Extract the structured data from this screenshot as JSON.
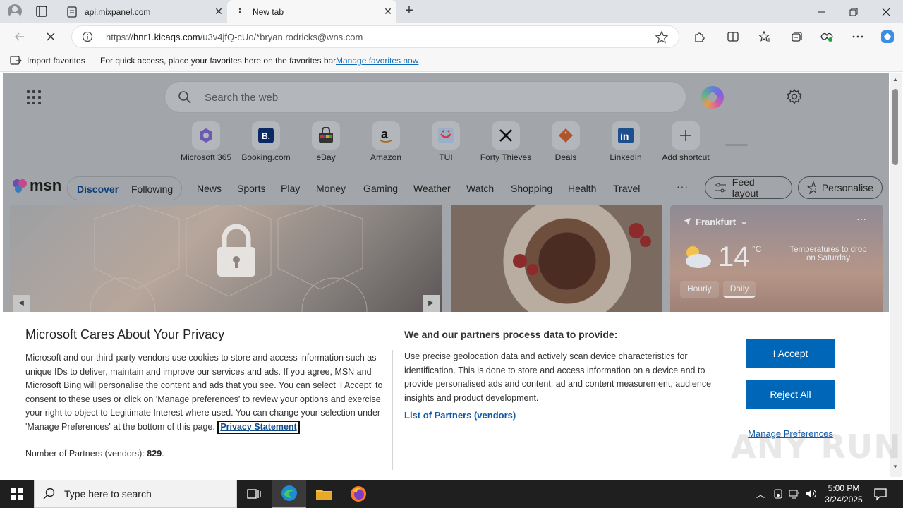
{
  "browser": {
    "tabs": [
      {
        "title": "api.mixpanel.com"
      },
      {
        "title": "New tab"
      }
    ],
    "address": {
      "scheme": "https://",
      "host": "hnr1.kicaqs.com",
      "path": "/u3v4jfQ-cUo/*bryan.rodricks@wns.com"
    },
    "favorites_bar": {
      "import_label": "Import favorites",
      "hint": "For quick access, place your favorites here on the favorites bar.",
      "manage_link": "Manage favorites now"
    }
  },
  "newtab": {
    "search_placeholder": "Search the web",
    "shortcuts": [
      {
        "label": "Microsoft 365",
        "icon": "microsoft-365-icon"
      },
      {
        "label": "Booking.com",
        "icon": "booking-icon"
      },
      {
        "label": "eBay",
        "icon": "ebay-icon"
      },
      {
        "label": "Amazon",
        "icon": "amazon-icon"
      },
      {
        "label": "TUI",
        "icon": "tui-icon"
      },
      {
        "label": "Forty Thieves",
        "icon": "forty-thieves-icon"
      },
      {
        "label": "Deals",
        "icon": "deals-icon"
      },
      {
        "label": "LinkedIn",
        "icon": "linkedin-icon"
      },
      {
        "label": "Add shortcut",
        "icon": "plus-icon"
      }
    ],
    "msn_brand": "msn",
    "feed_tabs": {
      "discover": "Discover",
      "following": "Following"
    },
    "categories": [
      "News",
      "Sports",
      "Play",
      "Money",
      "Gaming",
      "Weather",
      "Watch",
      "Shopping",
      "Health",
      "Travel"
    ],
    "feed_layout": "Feed layout",
    "personalise": "Personalise",
    "weather": {
      "city": "Frankfurt",
      "temp": "14",
      "unit": "°C",
      "note": "Temperatures to drop on Saturday",
      "tabs": [
        "Hourly",
        "Daily"
      ],
      "active_tab": "Daily"
    }
  },
  "consent": {
    "title": "Microsoft Cares About Your Privacy",
    "body": "Microsoft and our third-party vendors use cookies to store and access information such as unique IDs to deliver, maintain and improve our services and ads. If you agree, MSN and Microsoft Bing will personalise the content and ads that you see. You can select 'I Accept' to consent to these uses or click on 'Manage preferences' to review your options and exercise your right to object to Legitimate Interest where used.  You can change your selection under 'Manage Preferences' at the bottom of this page.",
    "privacy_link": "Privacy Statement",
    "partners_count_label": "Number of Partners (vendors):",
    "partners_count": "829",
    "right_title": "We and our partners process data to provide:",
    "right_body": "Use precise geolocation data and actively scan device characteristics for identification. This is done to store and access information on a device and to provide personalised ads and content, ad and content measurement, audience insights and product development.",
    "partners_link": "List of Partners (vendors)",
    "accept": "I Accept",
    "reject": "Reject All",
    "manage": "Manage Preferences"
  },
  "watermark": "ANY RUN",
  "taskbar": {
    "search_placeholder": "Type here to search",
    "time": "5:00 PM",
    "date": "3/24/2025"
  },
  "colors": {
    "accent": "#0067b8",
    "link": "#0f5aa8",
    "overlay": "#a2a5a9",
    "taskbar": "#1f1f1f"
  }
}
